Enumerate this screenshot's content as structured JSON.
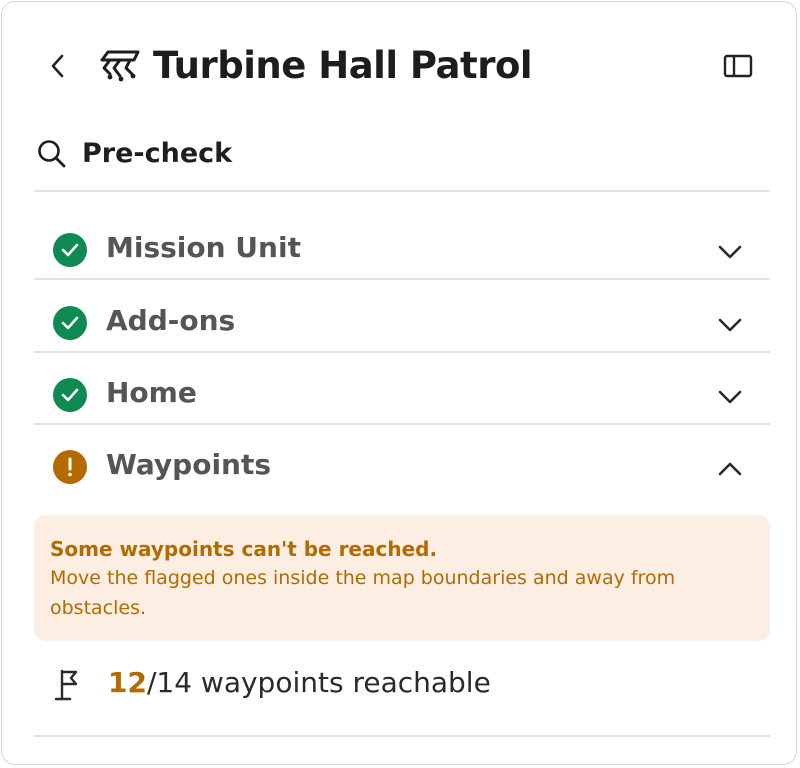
{
  "header": {
    "title": "Turbine Hall Patrol",
    "back_icon": "chevron-left-icon",
    "mission_icon": "robot-dog-icon",
    "panel_icon": "sidebar-panel-icon"
  },
  "precheck": {
    "title": "Pre-check",
    "icon": "search-icon"
  },
  "checks": [
    {
      "label": "Mission Unit",
      "status": "ok",
      "expanded": false
    },
    {
      "label": "Add-ons",
      "status": "ok",
      "expanded": false
    },
    {
      "label": "Home",
      "status": "ok",
      "expanded": false
    },
    {
      "label": "Waypoints",
      "status": "warning",
      "expanded": true
    }
  ],
  "alert": {
    "title": "Some waypoints can't be reached.",
    "body": "Move the flagged ones inside the map boundaries and away from obstacles."
  },
  "waypoints": {
    "reachable": "12",
    "total_text": "/14 waypoints reachable",
    "icon": "flag-icon"
  },
  "colors": {
    "ok": "#0e8a52",
    "warning": "#b36b00",
    "alert_bg": "#fdeee4",
    "divider": "#e3e3e3"
  }
}
